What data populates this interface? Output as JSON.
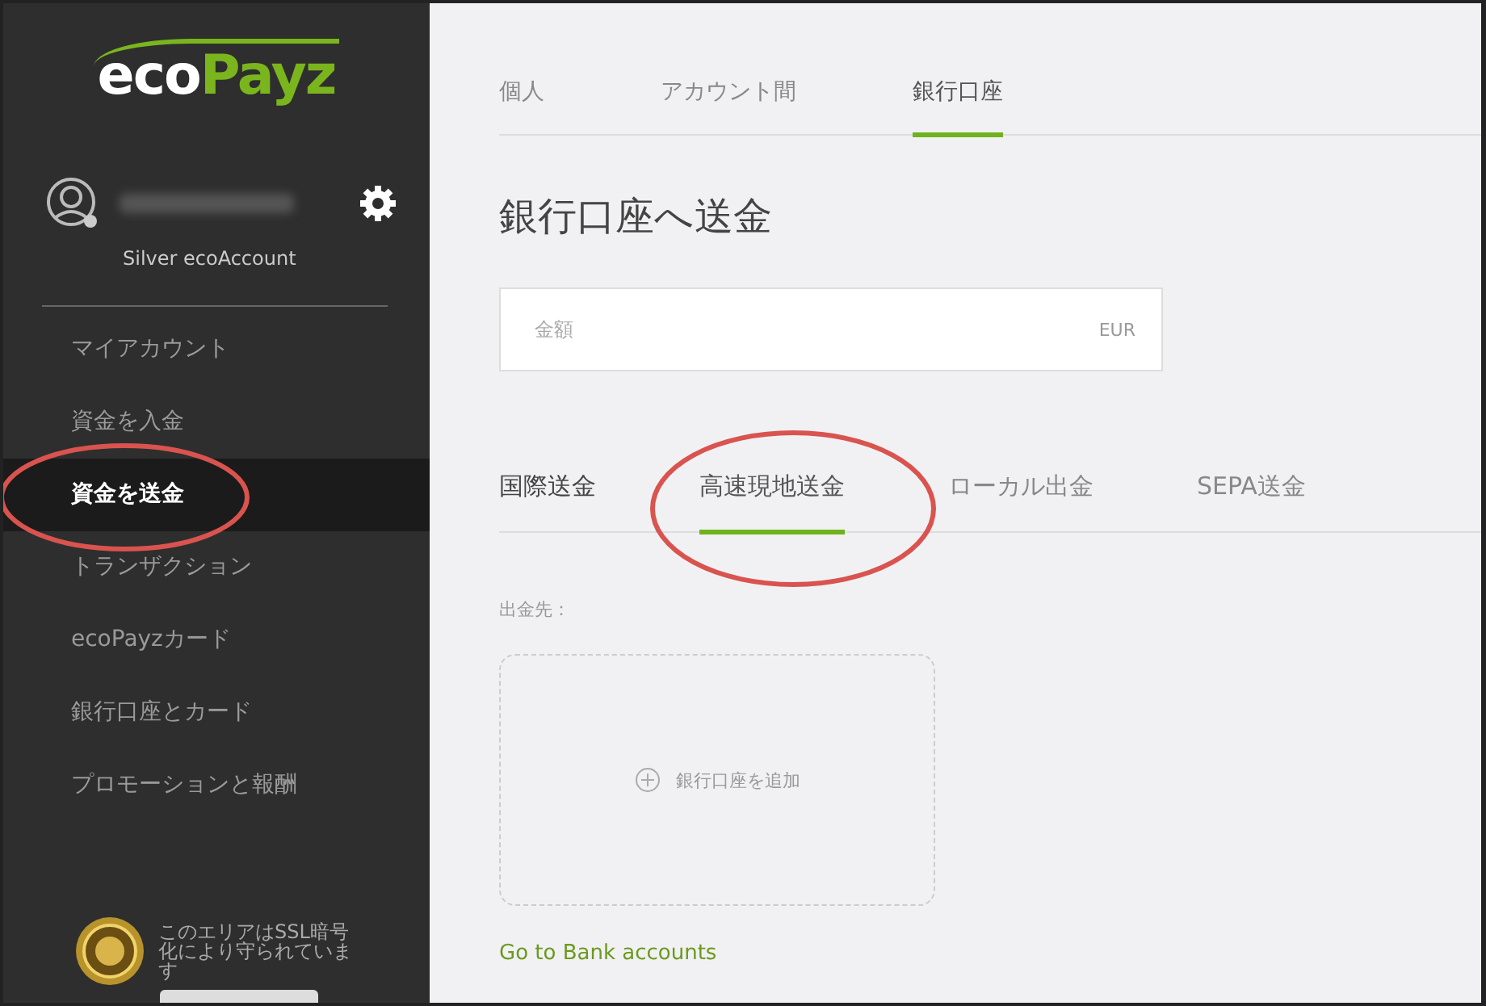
{
  "sidebar": {
    "logo": {
      "prefix": "eco",
      "suffix": "Payz"
    },
    "account_type": "Silver ecoAccount",
    "items": [
      {
        "label": "マイアカウント",
        "selected": false
      },
      {
        "label": "資金を入金",
        "selected": false
      },
      {
        "label": "資金を送金",
        "selected": true
      },
      {
        "label": "トランザクション",
        "selected": false
      },
      {
        "label": "ecoPayzカード",
        "selected": false
      },
      {
        "label": "銀行口座とカード",
        "selected": false
      },
      {
        "label": "プロモーションと報酬",
        "selected": false
      }
    ],
    "ssl_note": "このエリアはSSL暗号化により守られています"
  },
  "tabs": [
    {
      "label": "個人",
      "selected": false
    },
    {
      "label": "アカウント間",
      "selected": false
    },
    {
      "label": "銀行口座",
      "selected": true
    }
  ],
  "title": "銀行口座へ送金",
  "amount_field": {
    "placeholder": "金額",
    "currency": "EUR"
  },
  "subtabs": [
    {
      "label": "国際送金",
      "selected": false
    },
    {
      "label": "高速現地送金",
      "selected": true
    },
    {
      "label": "ローカル出金",
      "selected": false
    },
    {
      "label": "SEPA送金",
      "selected": false
    }
  ],
  "destination_label": "出金先：",
  "add_bank_account": "銀行口座を追加",
  "bank_accounts_link": "Go to Bank accounts"
}
